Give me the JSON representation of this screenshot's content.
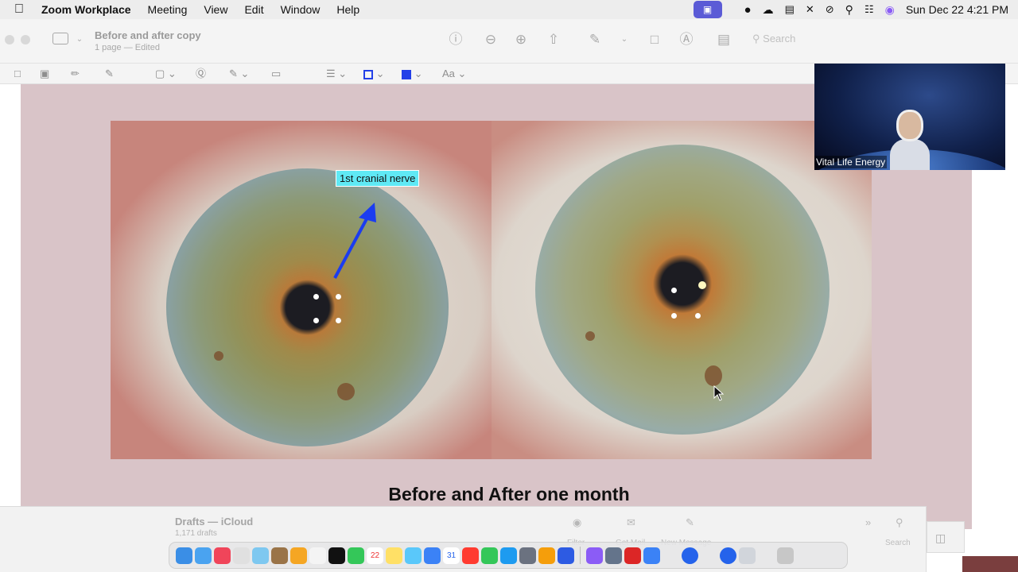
{
  "menubar": {
    "app_name": "Zoom Workplace",
    "menus": [
      "Meeting",
      "View",
      "Edit",
      "Window",
      "Help"
    ],
    "datetime": "Sun Dec 22  4:21 PM"
  },
  "preview": {
    "doc_title": "Before and after  copy",
    "doc_subtitle": "1 page — Edited",
    "search_placeholder": "Search",
    "font_button": "Aa"
  },
  "document": {
    "annotation_label": "1st cranial nerve",
    "caption": "Before and After one month",
    "arrow_color": "#1b3cf0",
    "label_bg": "#5fe9f5"
  },
  "video": {
    "participant_name": "Vital Life Energy"
  },
  "mail": {
    "title": "Drafts — iCloud",
    "count": "1,171 drafts",
    "filter_label": "Filter",
    "get_mail_label": "Get Mail",
    "new_message_label": "New Message",
    "search_label": "Search"
  },
  "dock": {
    "calendar_day": "22",
    "calendar_day2": "31"
  }
}
